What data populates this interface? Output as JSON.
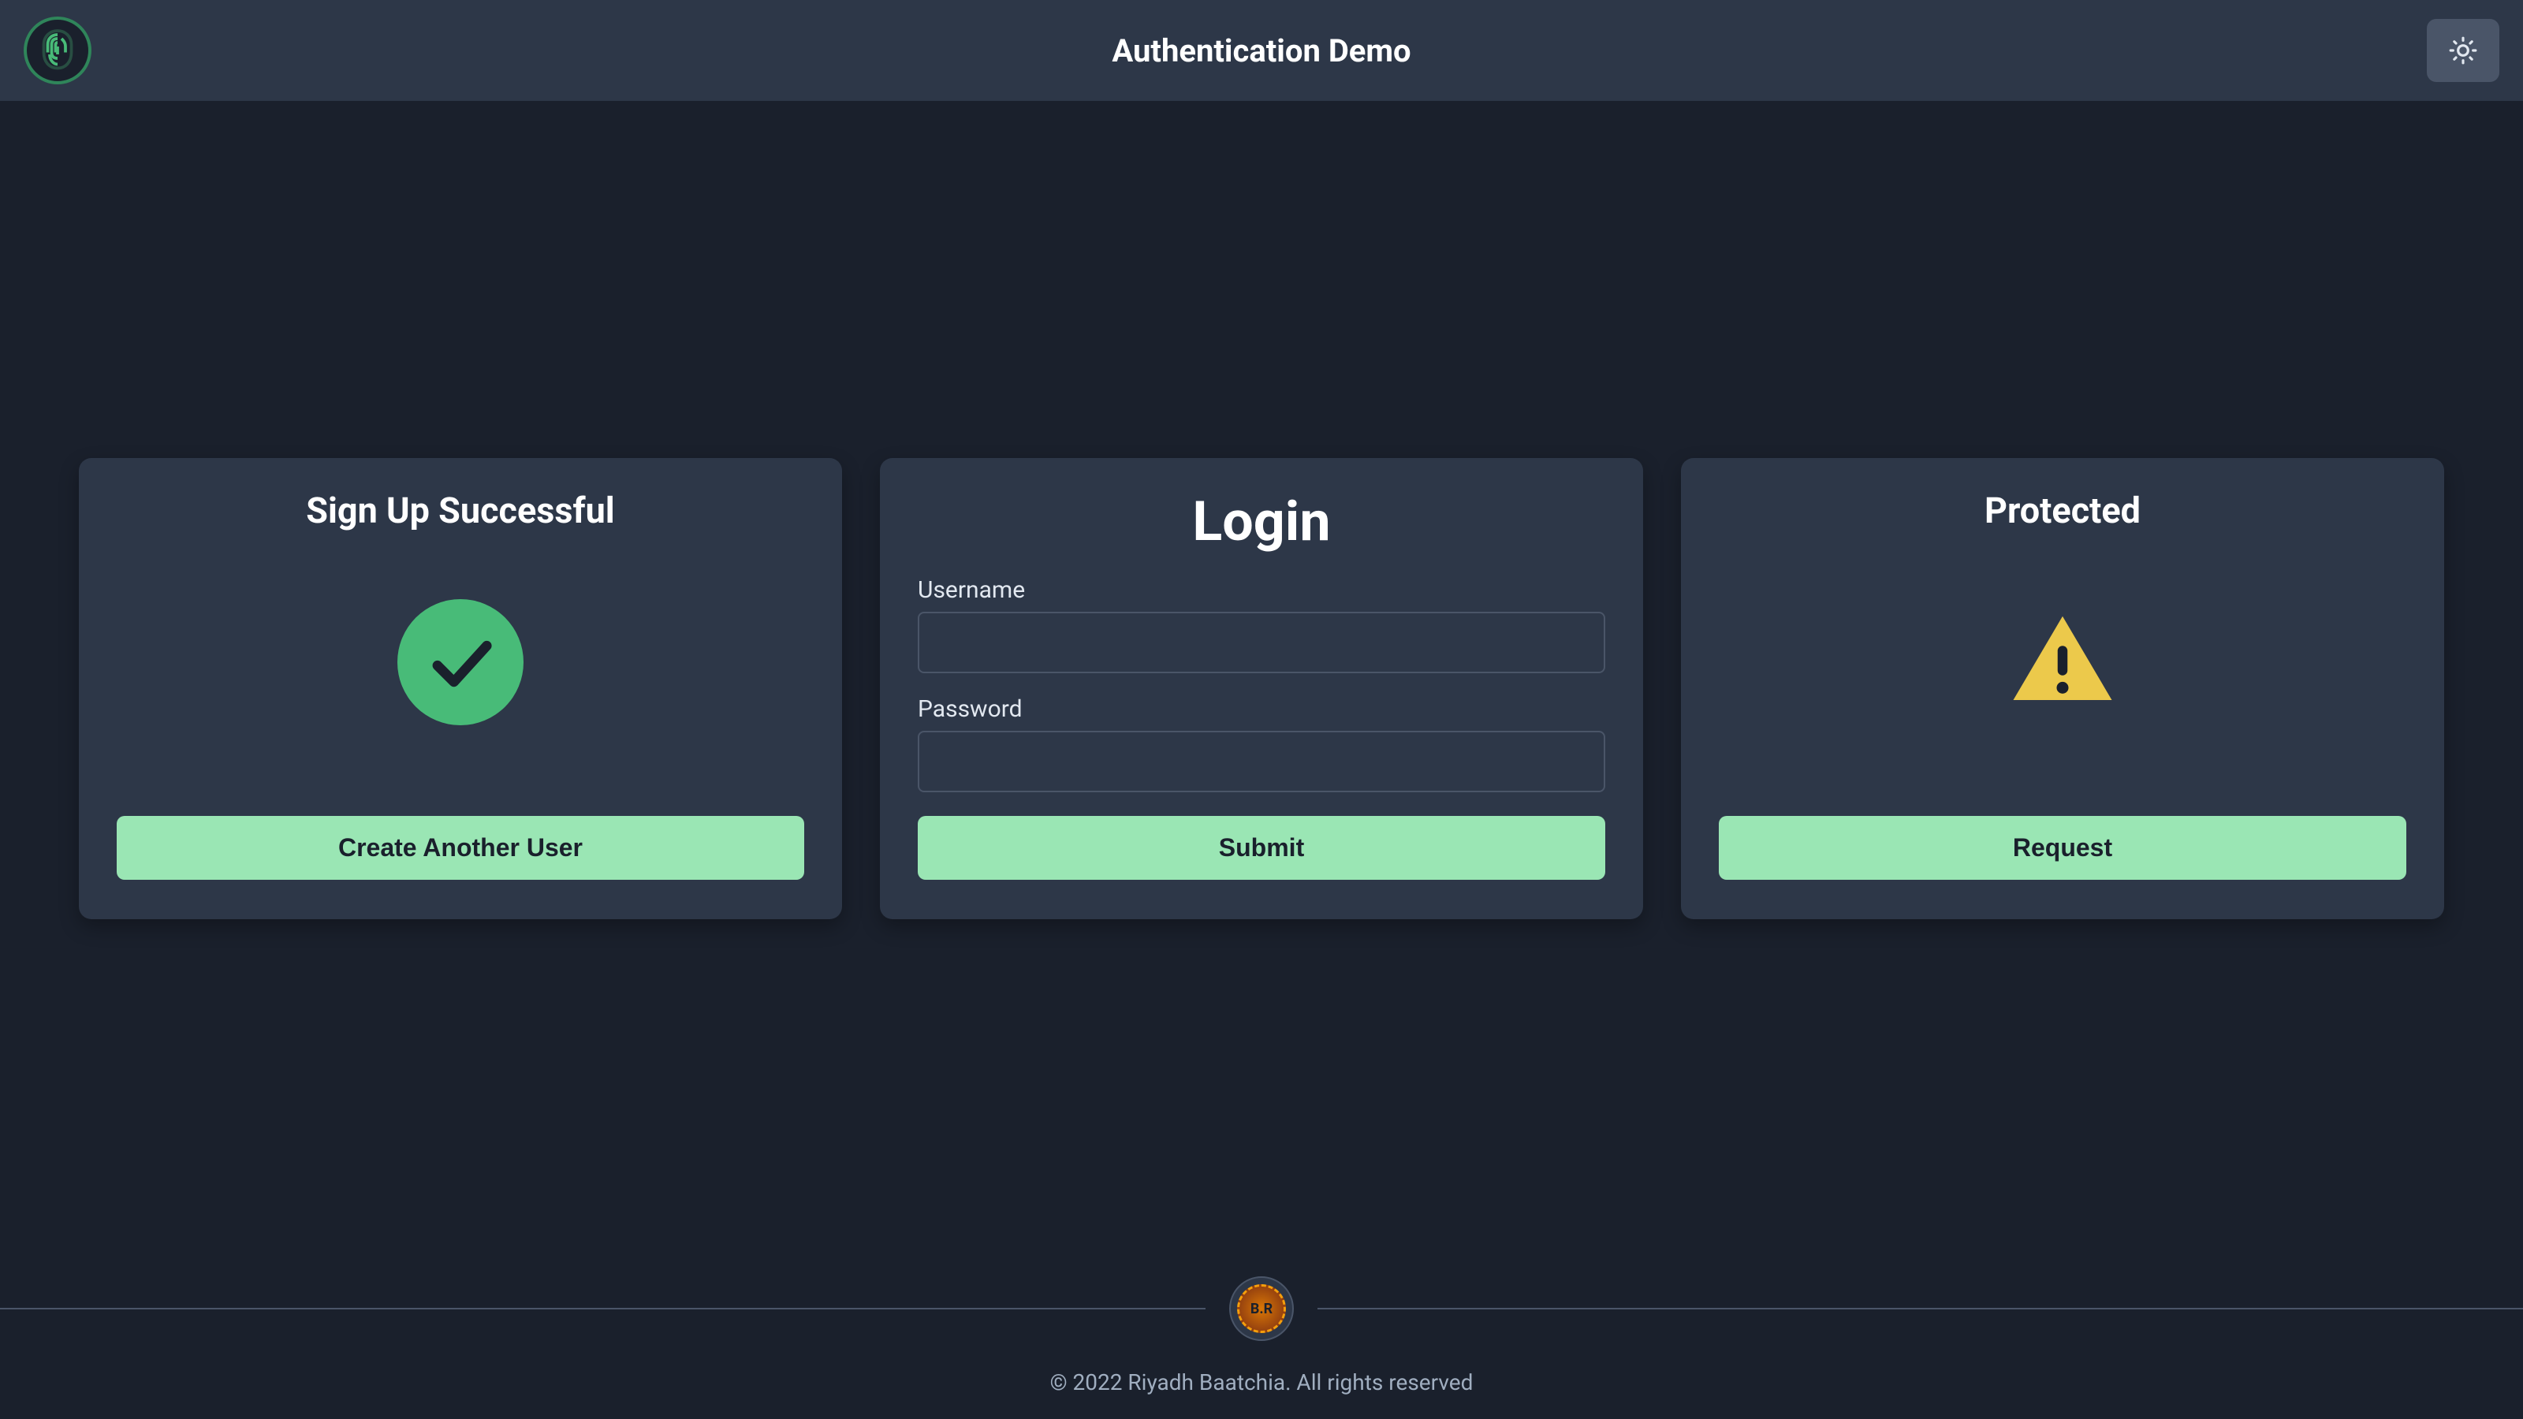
{
  "header": {
    "title": "Authentication Demo"
  },
  "cards": {
    "signup": {
      "title": "Sign Up Successful",
      "button_label": "Create Another User"
    },
    "login": {
      "title": "Login",
      "username_label": "Username",
      "username_value": "",
      "password_label": "Password",
      "password_value": "",
      "button_label": "Submit"
    },
    "protected": {
      "title": "Protected",
      "button_label": "Request"
    }
  },
  "footer": {
    "avatar_text": "B.R",
    "copyright": "© 2022 Riyadh Baatchia. All rights reserved"
  },
  "colors": {
    "background": "#1a202c",
    "card_bg": "#2d3748",
    "accent_green": "#9ae6b4",
    "success_green": "#48bb78",
    "warning_yellow": "#ecc94b",
    "text_primary": "#ffffff",
    "text_secondary": "#e2e8f0",
    "border": "#4a5568"
  }
}
